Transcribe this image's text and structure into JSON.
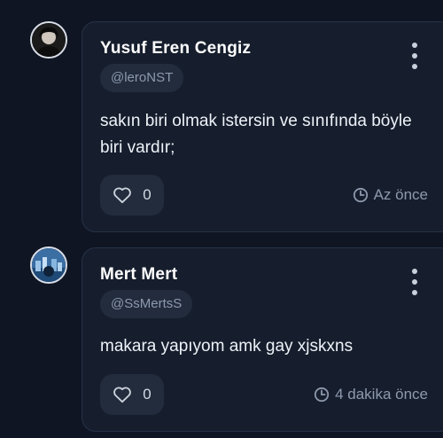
{
  "comments": [
    {
      "author": "Yusuf Eren Cengiz",
      "handle": "@leroNST",
      "text": "sakın biri olmak istersin ve sınıfında böyle biri vardır;",
      "likes": "0",
      "time": "Az önce"
    },
    {
      "author": "Mert Mert",
      "handle": "@SsMertsS",
      "text": "makara yapıyom amk gay xjskxns",
      "likes": "0",
      "time": "4 dakika önce"
    }
  ],
  "icons": {
    "like": "heart-icon",
    "time": "clock-icon",
    "menu": "kebab-menu-icon"
  },
  "colors": {
    "background": "#0f1523",
    "card": "#161e2d",
    "chip": "#222c3d",
    "muted_text": "#8d99ad"
  }
}
